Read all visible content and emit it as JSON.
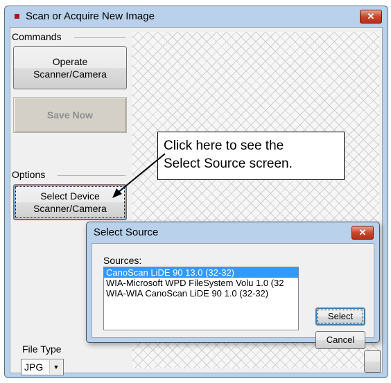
{
  "window": {
    "title": "Scan or Acquire New Image",
    "close_glyph": "✕"
  },
  "commands": {
    "group_label": "Commands",
    "operate_line1": "Operate",
    "operate_line2": "Scanner/Camera",
    "save_now": "Save Now"
  },
  "options": {
    "group_label": "Options",
    "select_line1": "Select Device",
    "select_line2": "Scanner/Camera"
  },
  "callout": {
    "line1": "Click here to see the",
    "line2": "Select Source screen."
  },
  "file_type": {
    "label": "File Type",
    "value": "JPG",
    "arrow": "▼"
  },
  "dialog": {
    "title": "Select Source",
    "close_glyph": "✕",
    "sources_label": "Sources:",
    "sources": [
      "CanoScan LiDE 90 13.0 (32-32)",
      "WIA-Microsoft WPD FileSystem Volu 1.0 (32",
      "WIA-WIA CanoScan LiDE 90 1.0 (32-32)"
    ],
    "selected_index": 0,
    "select_button": "Select",
    "cancel_button": "Cancel"
  },
  "colors": {
    "title_mark": "#b0102a",
    "selection": "#3399ff",
    "close": "#c9472b"
  }
}
